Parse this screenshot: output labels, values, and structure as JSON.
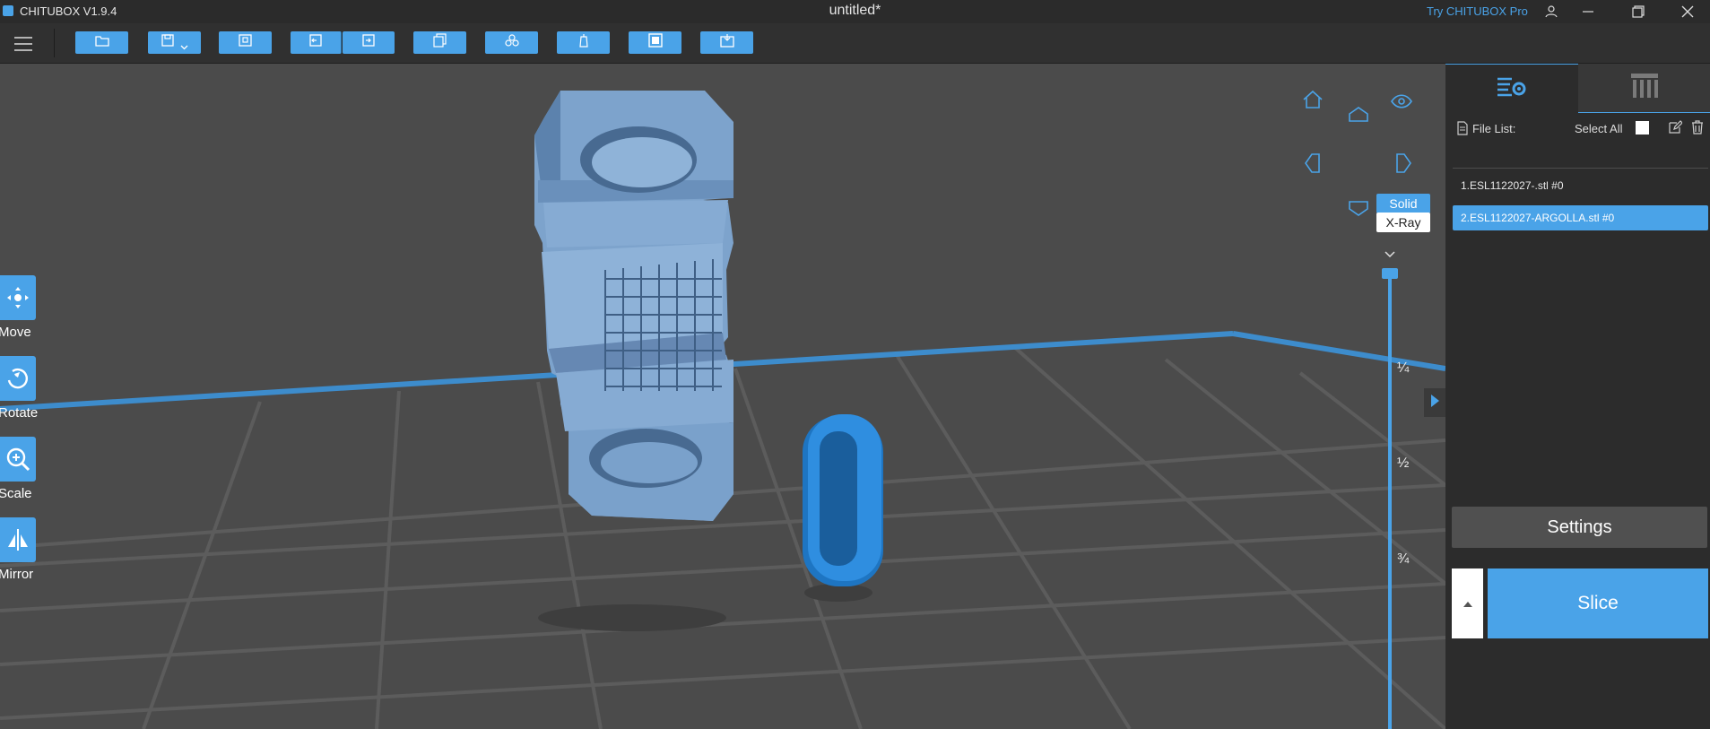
{
  "titlebar": {
    "app_name": "CHITUBOX V1.9.4",
    "doc_title": "untitled*",
    "pro_link": "Try CHITUBOX Pro"
  },
  "toolbar": {
    "icons": [
      "open-folder-icon",
      "save-icon",
      "import-icon",
      "undo-icon",
      "redo-icon",
      "copy-icon",
      "arrange-icon",
      "support-icon",
      "hollow-icon",
      "dig-hole-icon"
    ]
  },
  "left_tools": [
    {
      "label": "Move",
      "icon": "move-icon"
    },
    {
      "label": "Rotate",
      "icon": "rotate-icon"
    },
    {
      "label": "Scale",
      "icon": "scale-icon"
    },
    {
      "label": "Mirror",
      "icon": "mirror-icon"
    }
  ],
  "view": {
    "solid_label": "Solid",
    "xray_label": "X-Ray",
    "slider_marks": [
      "¼",
      "½",
      "¾"
    ]
  },
  "right_panel": {
    "file_list_label": "File List:",
    "select_all_label": "Select All",
    "files": [
      {
        "name": "1.ESL1122027-.stl #0",
        "selected": false
      },
      {
        "name": "2.ESL1122027-ARGOLLA.stl #0",
        "selected": true
      }
    ],
    "settings_label": "Settings",
    "slice_label": "Slice"
  },
  "colors": {
    "accent": "#4aa3e8",
    "model": "#7da3cc",
    "panel_bg": "#2c2c2c",
    "viewport_bg": "#4a4a4a"
  }
}
